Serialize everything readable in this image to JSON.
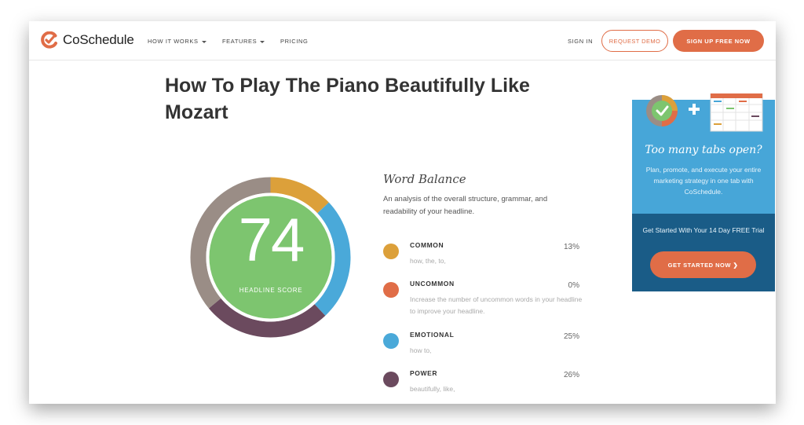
{
  "nav": {
    "brand": "CoSchedule",
    "links": [
      "HOW IT WORKS",
      "FEATURES",
      "PRICING"
    ],
    "sign_in": "SIGN IN",
    "request_demo": "REQUEST DEMO",
    "sign_up": "SIGN UP FREE NOW"
  },
  "headline": "How To Play The Piano Beautifully Like Mozart",
  "score": {
    "value": "74",
    "label": "HEADLINE SCORE",
    "fill_color": "#7dc56f",
    "ring_segments": [
      {
        "name": "common",
        "color": "#dca03a",
        "fraction": 0.13
      },
      {
        "name": "emotional",
        "color": "#4aa9d9",
        "fraction": 0.25
      },
      {
        "name": "power",
        "color": "#6b4a5e",
        "fraction": 0.26
      },
      {
        "name": "other",
        "color": "#9a8d86",
        "fraction": 0.36
      }
    ]
  },
  "word_balance": {
    "title": "Word Balance",
    "description": "An analysis of the overall structure, grammar, and readability of your headline.",
    "categories": [
      {
        "name": "COMMON",
        "percent": "13%",
        "words": "how, the, to,",
        "color": "#dca03a"
      },
      {
        "name": "UNCOMMON",
        "percent": "0%",
        "words": "Increase the number of uncommon words in your headline to improve your headline.",
        "color": "#e06d47"
      },
      {
        "name": "EMOTIONAL",
        "percent": "25%",
        "words": "how to,",
        "color": "#4aa9d9"
      },
      {
        "name": "POWER",
        "percent": "26%",
        "words": "beautifully, like,",
        "color": "#6b4a5e"
      }
    ]
  },
  "ad": {
    "heading": "Too many tabs open?",
    "body": "Plan, promote, and execute your entire marketing strategy in one tab with CoSchedule.",
    "trial": "Get Started With Your 14 Day FREE Trial",
    "cta": "GET STARTED NOW ❯",
    "top_color": "#47a6d8",
    "bottom_color": "#1a5c87"
  }
}
